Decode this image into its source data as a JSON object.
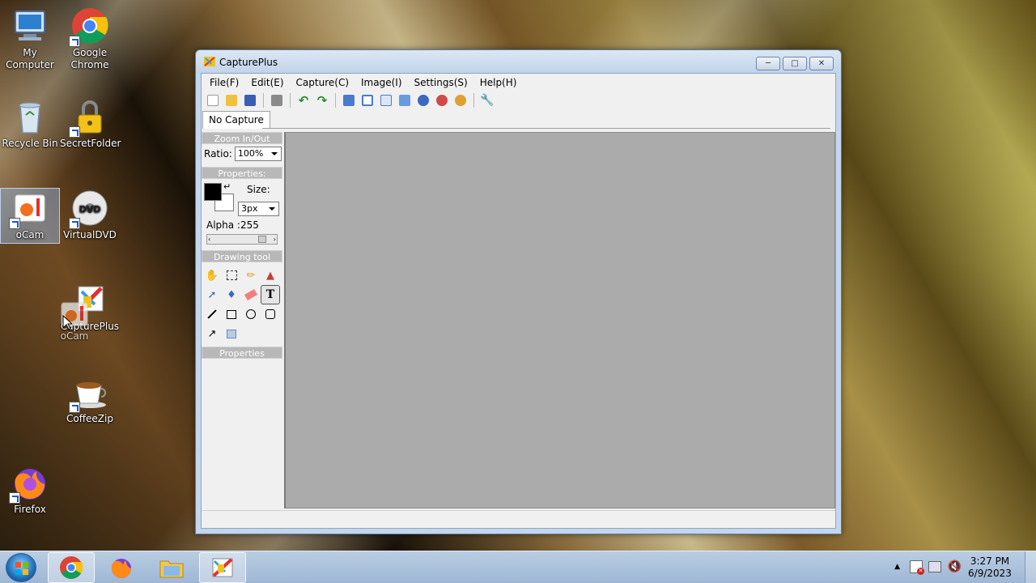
{
  "desktop": {
    "icons": [
      {
        "label": "My Computer"
      },
      {
        "label": "Google Chrome"
      },
      {
        "label": "Recycle Bin"
      },
      {
        "label": "SecretFolder"
      },
      {
        "label": "oCam"
      },
      {
        "label": "VirtualDVD"
      },
      {
        "label": "CapturePlus"
      },
      {
        "label": "oCam"
      },
      {
        "label": "CoffeeZip"
      },
      {
        "label": "Firefox"
      }
    ]
  },
  "window": {
    "title": "CapturePlus",
    "menu": [
      "File(F)",
      "Edit(E)",
      "Capture(C)",
      "Image(I)",
      "Settings(S)",
      "Help(H)"
    ],
    "tab_label": "No Capture",
    "panel": {
      "zoom_header": "Zoom In/Out",
      "ratio_label": "Ratio:",
      "ratio_value": "100%",
      "properties_header": "Properties:",
      "size_label": "Size:",
      "size_value": "3px",
      "alpha_label": "Alpha :255",
      "drawing_header": "Drawing tool",
      "properties_footer": "Properties"
    },
    "colors": {
      "foreground": "#000000",
      "background": "#ffffff",
      "canvas": "#ababab"
    }
  },
  "taskbar": {
    "apps": [
      "start-button",
      "chrome-icon",
      "firefox-icon",
      "explorer-icon",
      "captureplus-icon"
    ],
    "clock_time": "3:27 PM",
    "clock_date": "6/9/2023"
  }
}
